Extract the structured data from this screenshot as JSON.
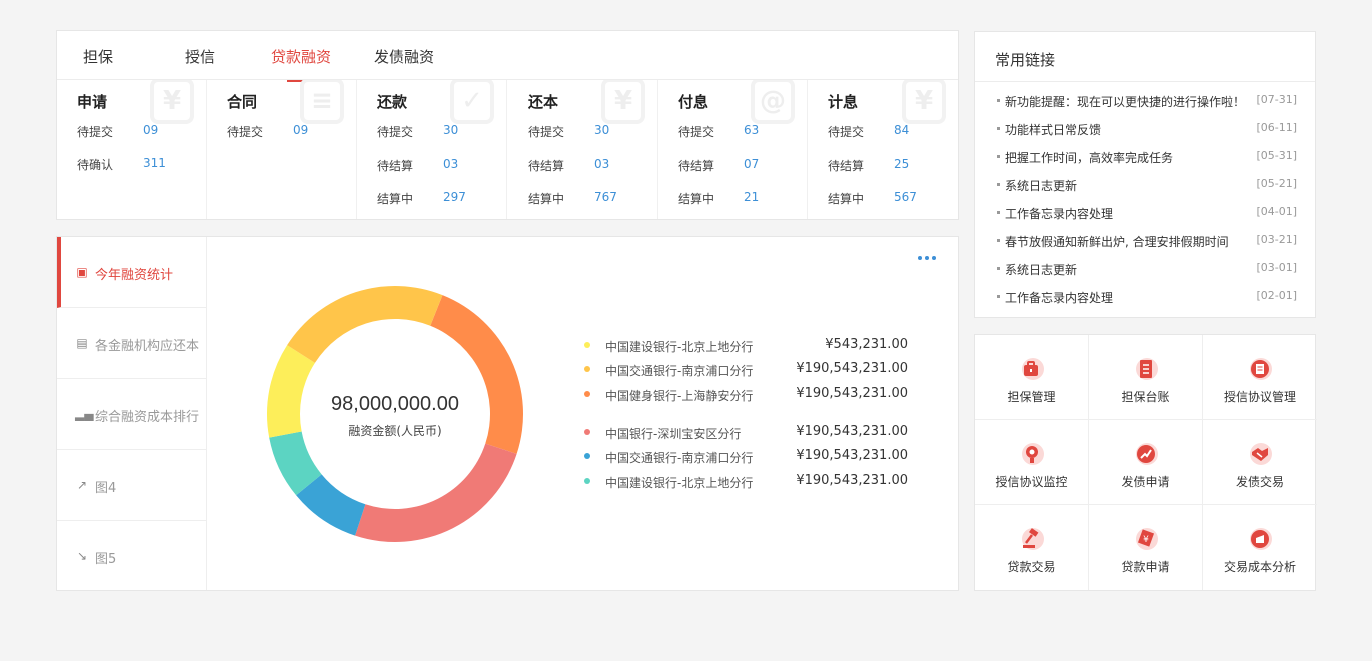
{
  "tabs": [
    {
      "label": "担保"
    },
    {
      "label": "授信"
    },
    {
      "label": "贷款融资"
    },
    {
      "label": "发债融资"
    }
  ],
  "columns": [
    {
      "title": "申请",
      "watermark": "¥",
      "rows": [
        {
          "label": "待提交",
          "value": "09"
        },
        {
          "label": "待确认",
          "value": "311"
        }
      ]
    },
    {
      "title": "合同",
      "watermark": "≡",
      "rows": [
        {
          "label": "待提交",
          "value": "09"
        }
      ]
    },
    {
      "title": "还款",
      "watermark": "✓",
      "rows": [
        {
          "label": "待提交",
          "value": "30"
        },
        {
          "label": "待结算",
          "value": "03"
        },
        {
          "label": "结算中",
          "value": "297"
        }
      ]
    },
    {
      "title": "还本",
      "watermark": "¥",
      "rows": [
        {
          "label": "待提交",
          "value": "30"
        },
        {
          "label": "待结算",
          "value": "03"
        },
        {
          "label": "结算中",
          "value": "767"
        }
      ]
    },
    {
      "title": "付息",
      "watermark": "@",
      "rows": [
        {
          "label": "待提交",
          "value": "63"
        },
        {
          "label": "待结算",
          "value": "07"
        },
        {
          "label": "结算中",
          "value": "21"
        }
      ]
    },
    {
      "title": "计息",
      "watermark": "¥",
      "rows": [
        {
          "label": "待提交",
          "value": "84"
        },
        {
          "label": "待结算",
          "value": "25"
        },
        {
          "label": "结算中",
          "value": "567"
        }
      ]
    }
  ],
  "side_nav": [
    {
      "label": "今年融资统计",
      "icon": "chart-icon"
    },
    {
      "label": "各金融机构应还本",
      "icon": "clipboard-icon"
    },
    {
      "label": "综合融资成本排行",
      "icon": "bars-icon"
    },
    {
      "label": "图4",
      "icon": "trend-up-icon"
    },
    {
      "label": "图5",
      "icon": "trend-down-icon"
    }
  ],
  "donut": {
    "center_value": "98,000,000.00",
    "center_label": "融资金额(人民币)"
  },
  "chart_data": {
    "type": "pie",
    "center_value": "98,000,000.00",
    "center_label": "融资金额(人民币)",
    "slices": [
      {
        "name": "中国健身银行-上海静安分行",
        "value": 24,
        "color": "#ff8c4a"
      },
      {
        "name": "中国银行-深圳宝安区分行",
        "value": 25,
        "color": "#f07a76"
      },
      {
        "name": "中国交通银行-南京浦口分行",
        "value": 9,
        "color": "#3aa3d6"
      },
      {
        "name": "中国建设银行-北京上地分行",
        "value": 8,
        "color": "#5cd4c2"
      },
      {
        "name": "中国建设银行-北京上地分行",
        "value": 12,
        "color": "#fdee5a"
      },
      {
        "name": "中国交通银行-南京浦口分行",
        "value": 22,
        "color": "#ffc54a"
      }
    ],
    "legend": [
      {
        "name": "中国建设银行-北京上地分行",
        "amount": "¥543,231.00",
        "color": "#fdee5a"
      },
      {
        "name": "中国交通银行-南京浦口分行",
        "amount": "¥190,543,231.00",
        "color": "#ffc54a"
      },
      {
        "name": "中国健身银行-上海静安分行",
        "amount": "¥190,543,231.00",
        "color": "#ff8c4a"
      },
      {
        "name": "中国银行-深圳宝安区分行",
        "amount": "¥190,543,231.00",
        "color": "#f07a76"
      },
      {
        "name": "中国交通银行-南京浦口分行",
        "amount": "¥190,543,231.00",
        "color": "#3aa3d6"
      },
      {
        "name": "中国建设银行-北京上地分行",
        "amount": "¥190,543,231.00",
        "color": "#5cd4c2"
      }
    ]
  },
  "links": {
    "title": "常用链接",
    "items": [
      {
        "text": "新功能提醒：现在可以更快捷的进行操作啦！",
        "date": "[07-31]"
      },
      {
        "text": "功能样式日常反馈",
        "date": "[06-11]"
      },
      {
        "text": "把握工作时间，高效率完成任务",
        "date": "[05-31]"
      },
      {
        "text": "系统日志更新",
        "date": "[05-21]"
      },
      {
        "text": "工作备忘录内容处理",
        "date": "[04-01]"
      },
      {
        "text": "春节放假通知新鲜出炉, 合理安排假期时间",
        "date": "[03-21]"
      },
      {
        "text": "系统日志更新",
        "date": "[03-01]"
      },
      {
        "text": "工作备忘录内容处理",
        "date": "[02-01]"
      }
    ]
  },
  "quick": [
    {
      "label": "担保管理",
      "icon": "briefcase-icon"
    },
    {
      "label": "担保台账",
      "icon": "ledger-icon"
    },
    {
      "label": "授信协议管理",
      "icon": "document-icon"
    },
    {
      "label": "授信协议监控",
      "icon": "monitor-icon"
    },
    {
      "label": "发债申请",
      "icon": "trend-icon"
    },
    {
      "label": "发债交易",
      "icon": "handshake-icon"
    },
    {
      "label": "贷款交易",
      "icon": "gavel-icon"
    },
    {
      "label": "贷款申请",
      "icon": "money-icon"
    },
    {
      "label": "交易成本分析",
      "icon": "analysis-icon"
    }
  ],
  "colors": {
    "accent": "#e0473f",
    "link": "#3d8fd6"
  }
}
